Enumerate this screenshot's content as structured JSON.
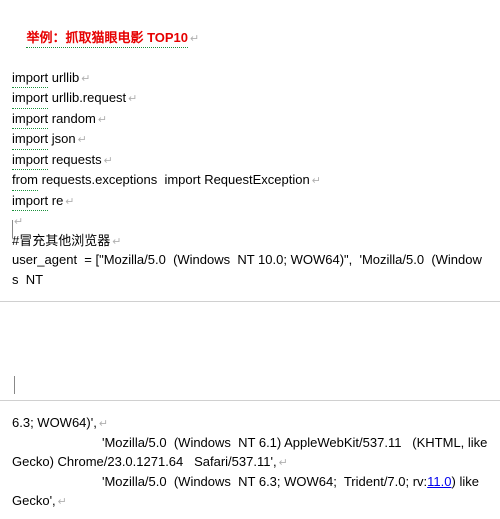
{
  "title": "举例：抓取猫眼电影 TOP10",
  "lines_top": [
    {
      "kw": "import",
      "rest": " urllib"
    },
    {
      "kw": "import",
      "rest": " urllib.request"
    },
    {
      "kw": "import",
      "rest": " random"
    },
    {
      "kw": "import",
      "rest": " json"
    },
    {
      "kw": "import",
      "rest": " requests"
    },
    {
      "kw": "from",
      "rest": " requests.exceptions  import RequestException"
    },
    {
      "kw": "import",
      "rest": " re"
    }
  ],
  "blank_pilcrow": "↵",
  "comment": "#冒充其他浏览器",
  "ua_line": "user_agent  = [\"Mozilla/5.0  (Windows  NT 10.0; WOW64)\",  'Mozilla/5.0  (Windows  NT",
  "lines_bottom": {
    "l1": "6.3; WOW64)',",
    "l2": "'Mozilla/5.0  (Windows  NT 6.1) AppleWebKit/537.11   (KHTML, like",
    "l3": "Gecko) Chrome/23.0.1271.64   Safari/537.11',",
    "l4_pre": "'Mozilla/5.0  (Windows  NT 6.3; WOW64;  Trident/7.0; rv:",
    "l4_link": "11.0",
    "l4_post": ") like",
    "l5": "Gecko',"
  },
  "pilcrow": "↵"
}
